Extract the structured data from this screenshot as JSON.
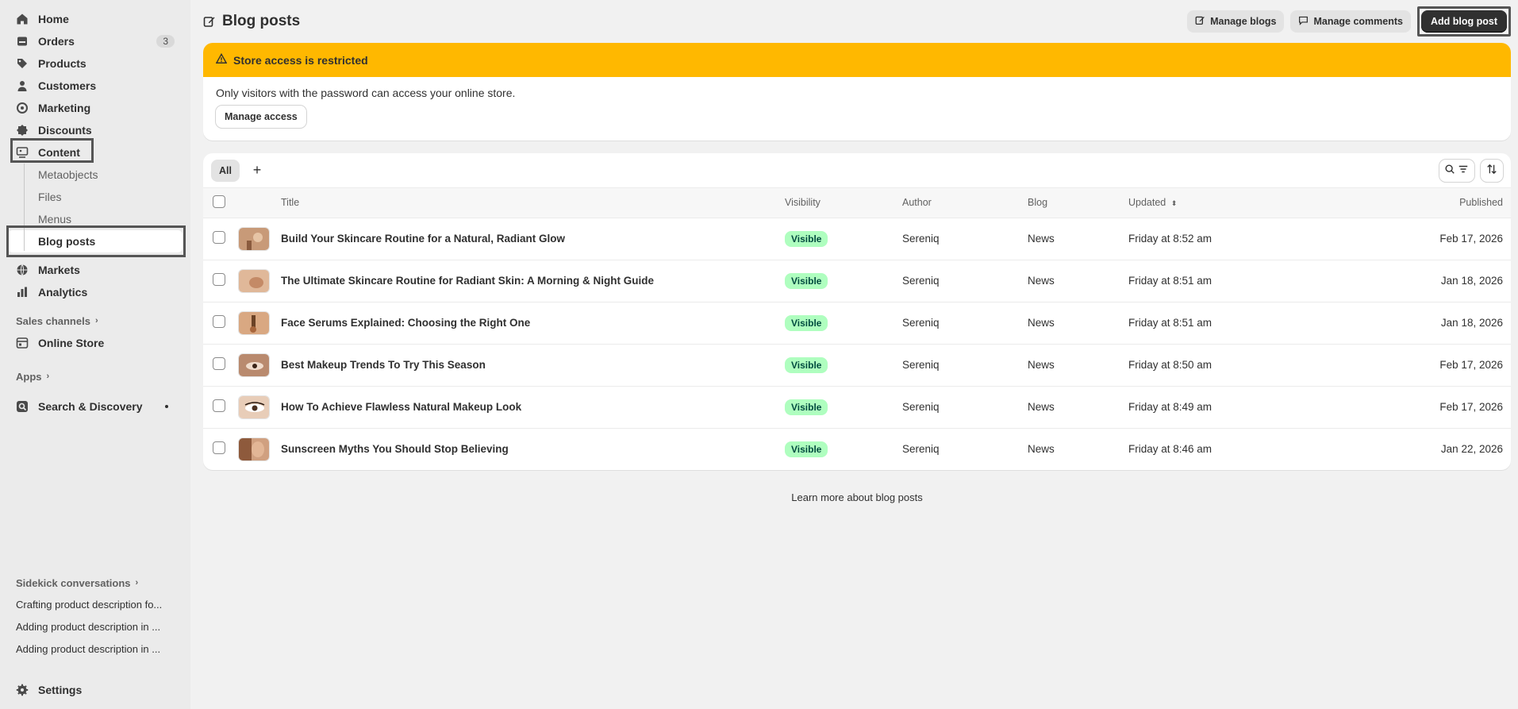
{
  "sidebar": {
    "items": [
      {
        "label": "Home",
        "icon": "home-icon"
      },
      {
        "label": "Orders",
        "icon": "orders-icon",
        "badge": "3"
      },
      {
        "label": "Products",
        "icon": "tag-icon"
      },
      {
        "label": "Customers",
        "icon": "person-icon"
      },
      {
        "label": "Marketing",
        "icon": "target-icon"
      },
      {
        "label": "Discounts",
        "icon": "discount-icon"
      },
      {
        "label": "Content",
        "icon": "content-icon"
      }
    ],
    "content_sub": [
      "Metaobjects",
      "Files",
      "Menus",
      "Blog posts"
    ],
    "items2": [
      {
        "label": "Markets",
        "icon": "globe-icon"
      },
      {
        "label": "Analytics",
        "icon": "chart-icon"
      }
    ],
    "sales_channels_label": "Sales channels",
    "online_store_label": "Online Store",
    "apps_label": "Apps",
    "search_discovery_label": "Search & Discovery",
    "sidekick_label": "Sidekick conversations",
    "conversations": [
      "Crafting product description fo...",
      "Adding product description in ...",
      "Adding product description in ..."
    ],
    "settings_label": "Settings"
  },
  "header": {
    "title": "Blog posts",
    "manage_blogs": "Manage blogs",
    "manage_comments": "Manage comments",
    "add_blog_post": "Add blog post"
  },
  "banner": {
    "title": "Store access is restricted",
    "text": "Only visitors with the password can access your online store.",
    "button": "Manage access",
    "color": "#ffb800"
  },
  "table": {
    "tab_all": "All",
    "columns": {
      "title": "Title",
      "visibility": "Visibility",
      "author": "Author",
      "blog": "Blog",
      "updated": "Updated",
      "published": "Published"
    },
    "rows": [
      {
        "title": "Build Your Skincare Routine for a Natural, Radiant Glow",
        "visibility": "Visible",
        "author": "Sereniq",
        "blog": "News",
        "updated": "Friday at 8:52 am",
        "published": "Feb 17, 2026"
      },
      {
        "title": "The Ultimate Skincare Routine for Radiant Skin: A Morning & Night Guide",
        "visibility": "Visible",
        "author": "Sereniq",
        "blog": "News",
        "updated": "Friday at 8:51 am",
        "published": "Jan 18, 2026"
      },
      {
        "title": "Face Serums Explained: Choosing the Right One",
        "visibility": "Visible",
        "author": "Sereniq",
        "blog": "News",
        "updated": "Friday at 8:51 am",
        "published": "Jan 18, 2026"
      },
      {
        "title": "Best Makeup Trends To Try This Season",
        "visibility": "Visible",
        "author": "Sereniq",
        "blog": "News",
        "updated": "Friday at 8:50 am",
        "published": "Feb 17, 2026"
      },
      {
        "title": "How To Achieve Flawless Natural Makeup Look",
        "visibility": "Visible",
        "author": "Sereniq",
        "blog": "News",
        "updated": "Friday at 8:49 am",
        "published": "Feb 17, 2026"
      },
      {
        "title": "Sunscreen Myths You Should Stop Believing",
        "visibility": "Visible",
        "author": "Sereniq",
        "blog": "News",
        "updated": "Friday at 8:46 am",
        "published": "Jan 22, 2026"
      }
    ]
  },
  "footer_link": "Learn more about blog posts",
  "colors": {
    "visible_badge_bg": "#affebf",
    "primary_button": "#303030"
  }
}
